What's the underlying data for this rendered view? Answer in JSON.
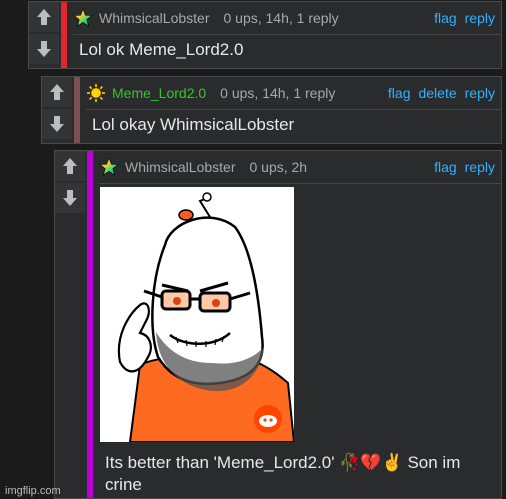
{
  "comments": [
    {
      "username": "WhimsicalLobster",
      "info": "0 ups, 14h, 1 reply",
      "actions": [
        "flag",
        "reply"
      ],
      "text": "Lol ok Meme_Lord2.0",
      "bar_color": "#e0262b",
      "user_color": "#a9a9a9",
      "icon": "rainbow-star-icon"
    },
    {
      "username": "Meme_Lord2.0",
      "info": "0 ups, 14h, 1 reply",
      "actions": [
        "flag",
        "delete",
        "reply"
      ],
      "text": "Lol okay WhimsicalLobster",
      "bar_color": "#7a5150",
      "user_color": "#37c52f",
      "icon": "sun-icon"
    },
    {
      "username": "WhimsicalLobster",
      "info": "0 ups, 2h",
      "actions": [
        "flag",
        "reply"
      ],
      "text": "Its better than 'Meme_Lord2.0' 🥀💔✌️ Son im crine",
      "bar_color": "#c000d8",
      "user_color": "#a9a9a9",
      "icon": "rainbow-star-icon",
      "image": "reddit-snoo-meme-image"
    }
  ],
  "watermark": "imgflip.com",
  "colors": {
    "link": "#2fb2ff",
    "text": "#e8e8e8",
    "meta": "#a9a9a9",
    "background": "#1b1b1b",
    "panel": "#2a2b2c"
  }
}
